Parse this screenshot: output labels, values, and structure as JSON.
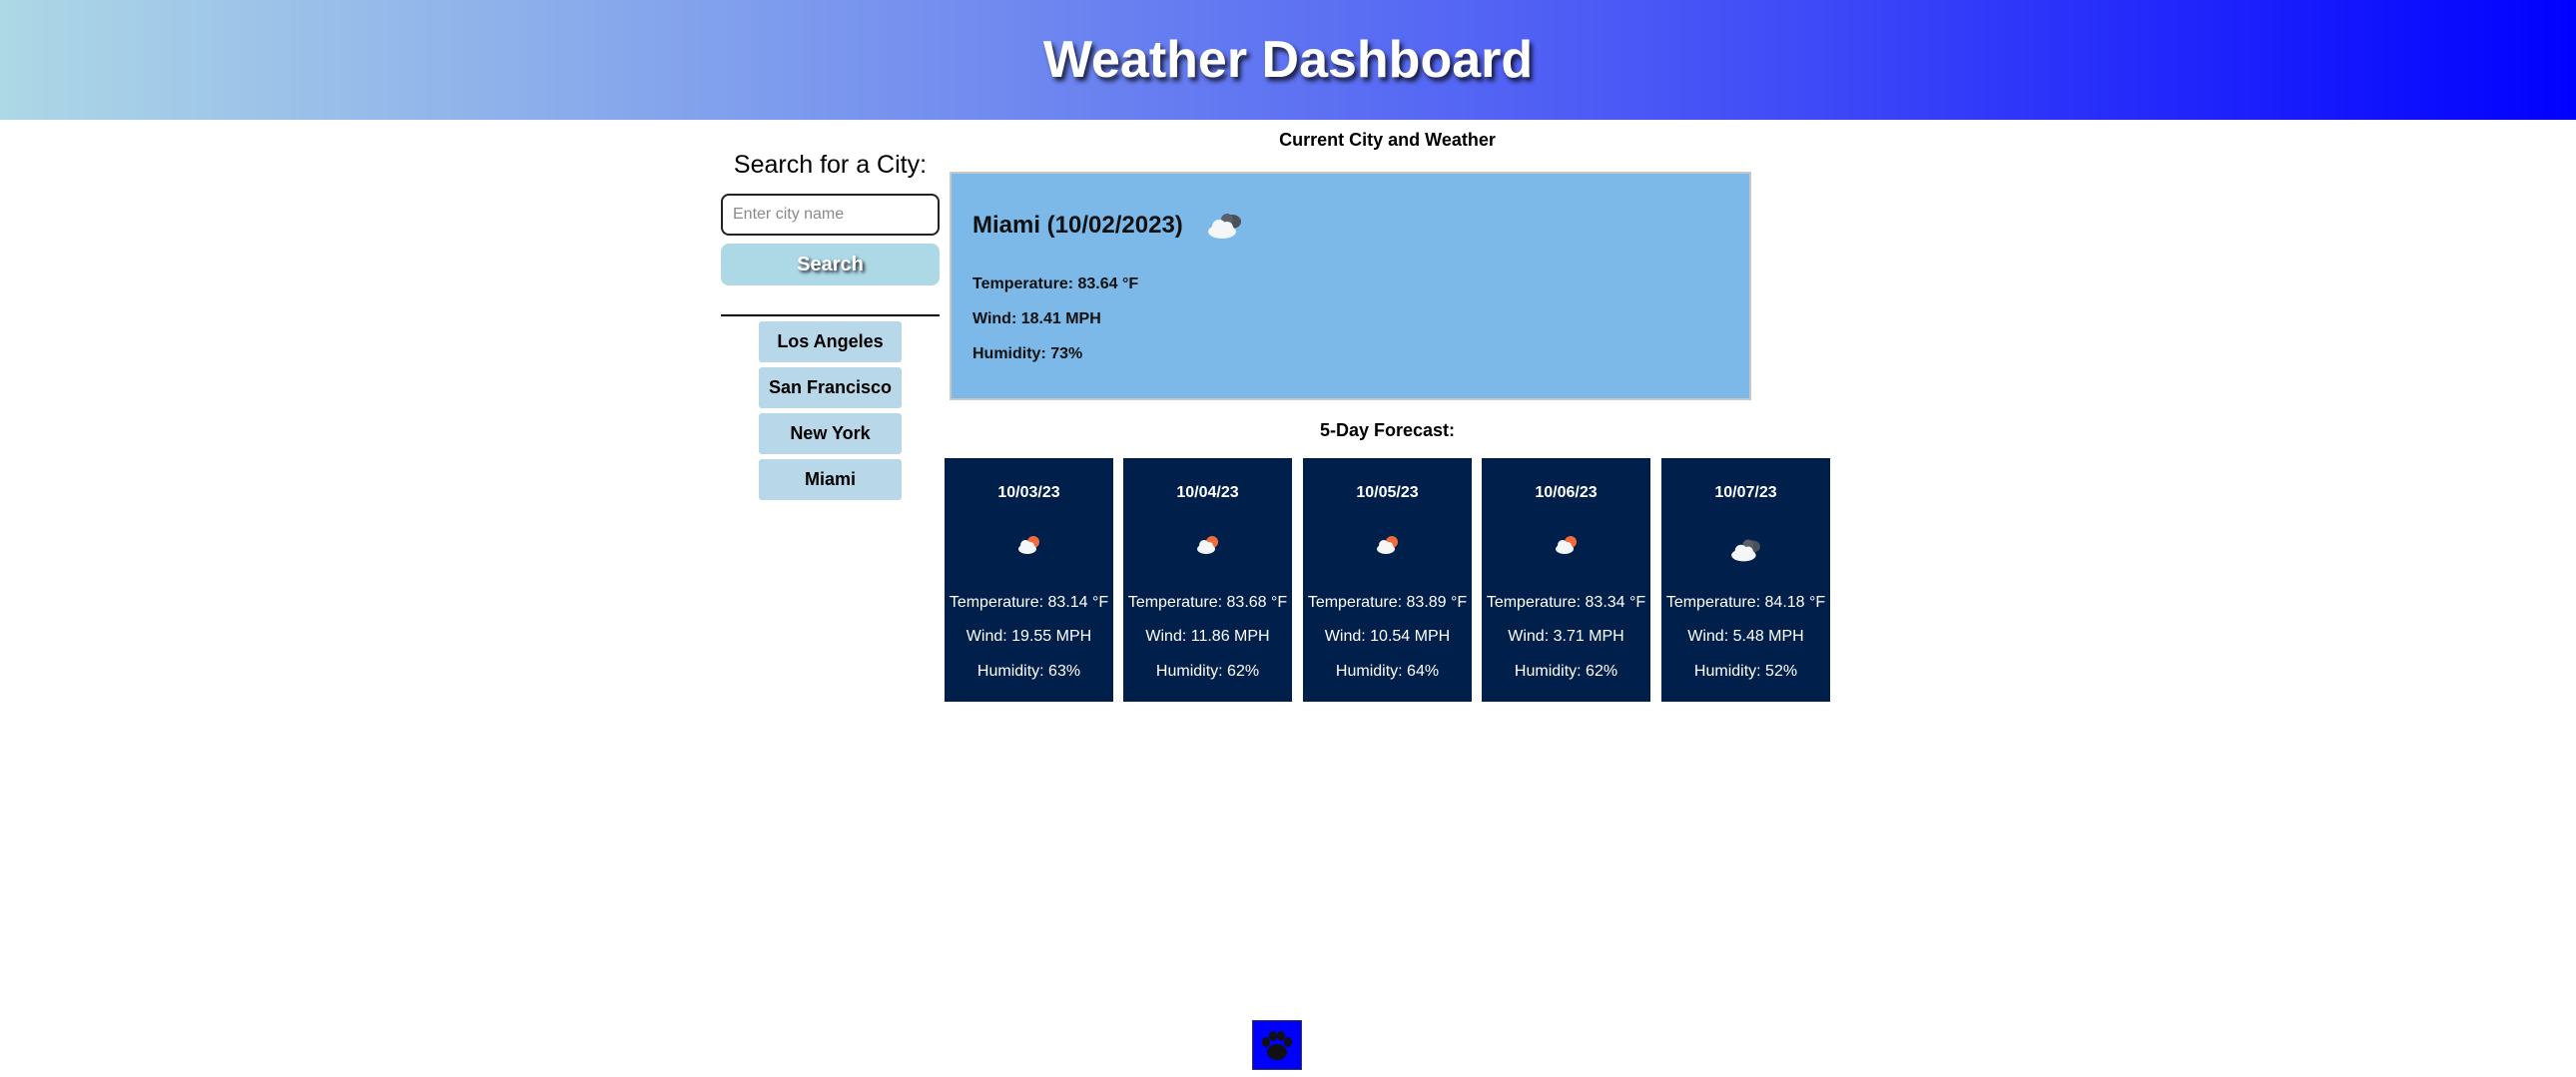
{
  "header": {
    "title": "Weather Dashboard"
  },
  "sidebar": {
    "heading": "Search for a City:",
    "search_placeholder": "Enter city name",
    "search_value": "",
    "search_button": "Search",
    "history": [
      {
        "label": "Los Angeles"
      },
      {
        "label": "San Francisco"
      },
      {
        "label": "New York"
      },
      {
        "label": "Miami"
      }
    ]
  },
  "current": {
    "section_title": "Current City and Weather",
    "city_date": "Miami (10/02/2023)",
    "icon": "broken-clouds-icon",
    "temperature": "Temperature: 83.64 °F",
    "wind": "Wind: 18.41 MPH",
    "humidity": "Humidity: 73%"
  },
  "forecast": {
    "section_title": "5-Day Forecast:",
    "days": [
      {
        "date": "10/03/23",
        "icon": "few-clouds-icon",
        "temperature": "Temperature: 83.14 °F",
        "wind": "Wind: 19.55 MPH",
        "humidity": "Humidity: 63%"
      },
      {
        "date": "10/04/23",
        "icon": "few-clouds-icon",
        "temperature": "Temperature: 83.68 °F",
        "wind": "Wind: 11.86 MPH",
        "humidity": "Humidity: 62%"
      },
      {
        "date": "10/05/23",
        "icon": "few-clouds-icon",
        "temperature": "Temperature: 83.89 °F",
        "wind": "Wind: 10.54 MPH",
        "humidity": "Humidity: 64%"
      },
      {
        "date": "10/06/23",
        "icon": "few-clouds-icon",
        "temperature": "Temperature: 83.34 °F",
        "wind": "Wind: 3.71 MPH",
        "humidity": "Humidity: 62%"
      },
      {
        "date": "10/07/23",
        "icon": "broken-clouds-icon",
        "temperature": "Temperature: 84.18 °F",
        "wind": "Wind: 5.48 MPH",
        "humidity": "Humidity: 52%"
      }
    ]
  },
  "footer": {
    "logo_icon": "paw-print-icon"
  },
  "colors": {
    "header_gradient_start": "#add8e6",
    "header_gradient_end": "#0000ff",
    "search_button_bg": "#add8e6",
    "history_button_bg": "#b8d8ea",
    "current_box_bg": "#7db9e8",
    "forecast_card_bg": "#011f4b",
    "footer_logo_bg": "#0000ff"
  }
}
